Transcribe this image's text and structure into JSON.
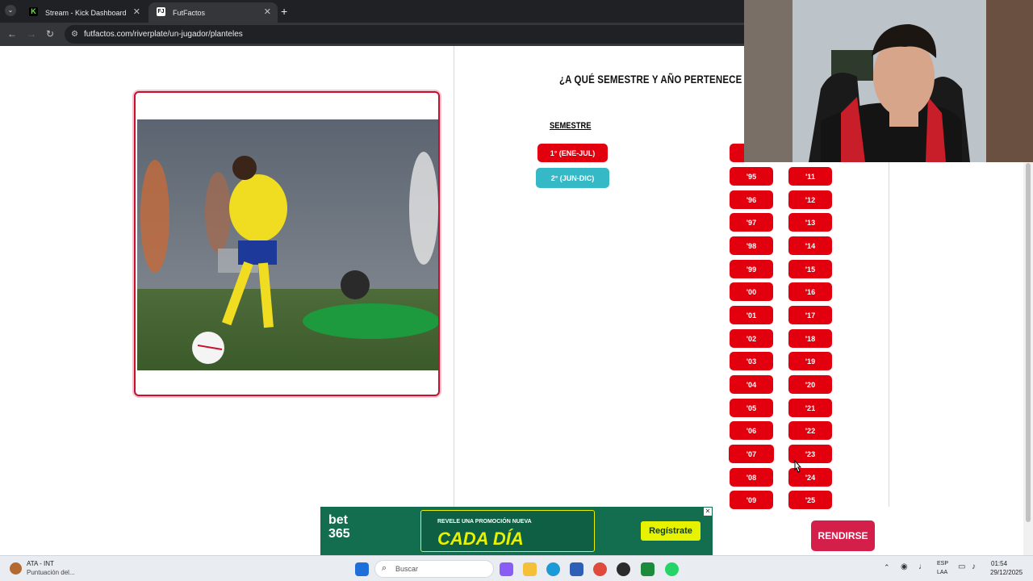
{
  "browser": {
    "tabs": [
      {
        "title": "Stream - Kick Dashboard",
        "favicon": "K"
      },
      {
        "title": "FutFactos",
        "favicon": "FJ"
      }
    ],
    "url": "futfactos.com/riverplate/un-jugador/planteles"
  },
  "quiz": {
    "question": "¿A QUÉ SEMESTRE Y AÑO PERTENECE L",
    "semester_title": "SEMESTRE",
    "semesters": [
      "1° (ENE-JUL)",
      "2° (JUN-DIC)"
    ],
    "years_col1": [
      "'95",
      "'96",
      "'97",
      "'98",
      "'99",
      "'00",
      "'01",
      "'02",
      "'03",
      "'04",
      "'05",
      "'06",
      "'07",
      "'08",
      "'09"
    ],
    "years_col2": [
      "'11",
      "'12",
      "'13",
      "'14",
      "'15",
      "'16",
      "'17",
      "'18",
      "'19",
      "'20",
      "'21",
      "'22",
      "'23",
      "'24",
      "'25"
    ],
    "surrender_label": "RENDIRSE"
  },
  "ad": {
    "brand": "bet 365",
    "promo_top": "REVELE UNA PROMOCIÓN NUEVA",
    "promo_main": "CADA DÍA",
    "cta": "Regístrate"
  },
  "taskbar": {
    "notification_title": "ATA - INT",
    "notification_sub": "Puntuación del...",
    "search_placeholder": "Buscar",
    "lang_top": "ESP",
    "lang_bottom": "LAA",
    "time": "01:54",
    "date": "29/12/2025"
  },
  "colors": {
    "accent_red": "#e2000f",
    "teal": "#35b9c6",
    "surrender": "#d41f4a"
  }
}
